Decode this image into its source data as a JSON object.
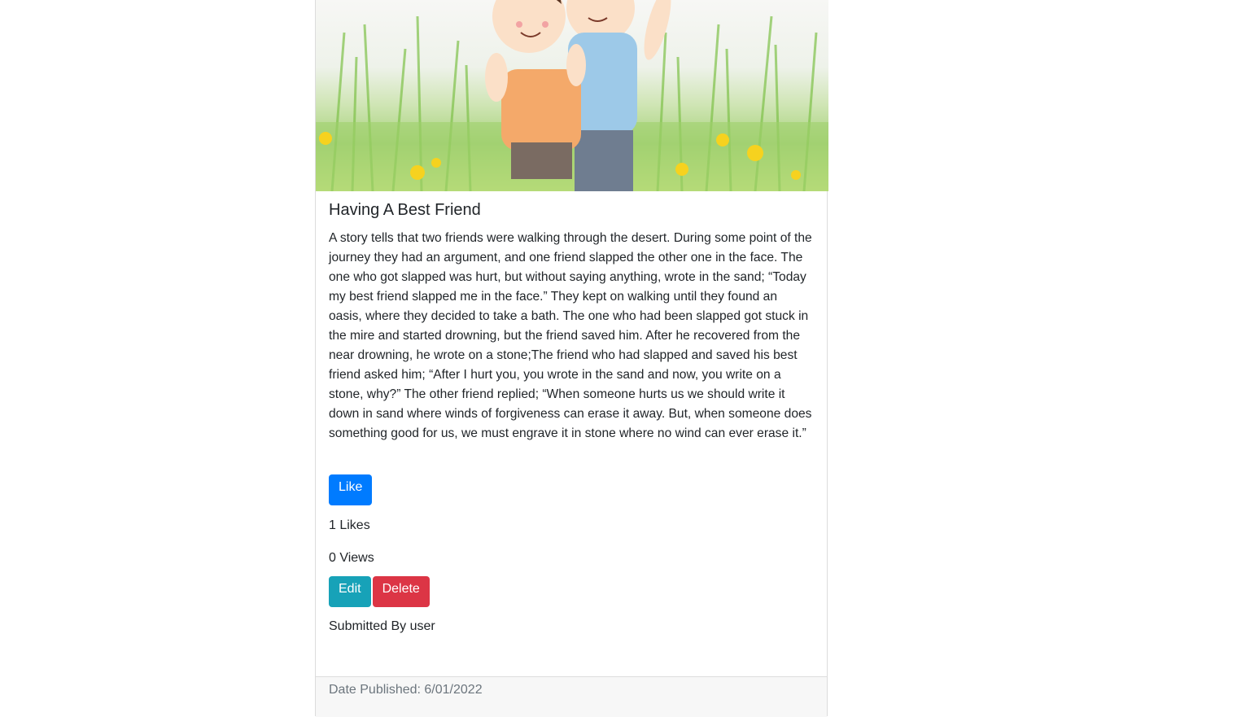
{
  "post": {
    "image_alt": "Two cartoon boys standing in a grassy field with yellow flowers",
    "title": "Having A Best Friend",
    "body": "A story tells that two friends were walking through the desert. During some point of the journey they had an argument, and one friend slapped the other one in the face. The one who got slapped was hurt, but without saying anything, wrote in the sand; “Today my best friend slapped me in the face.” They kept on walking until they found an oasis, where they decided to take a bath. The one who had been slapped got stuck in the mire and started drowning, but the friend saved him. After he recovered from the near drowning, he wrote on a stone;The friend who had slapped and saved his best friend asked him; “After I hurt you, you wrote in the sand and now, you write on a stone, why?” The other friend replied; “When someone hurts us we should write it down in sand where winds of forgiveness can erase it away. But, when someone does something good for us, we must engrave it in stone where no wind can ever erase it.”",
    "like_label": "Like",
    "likes_text": "1 Likes",
    "views_text": "0 Views",
    "edit_label": "Edit",
    "delete_label": "Delete",
    "submitted_text": "Submitted By user",
    "date_text": "Date Published: 6/01/2022"
  },
  "colors": {
    "primary": "#007bff",
    "info": "#17a2b8",
    "danger": "#dc3545",
    "muted": "#6c757d"
  }
}
